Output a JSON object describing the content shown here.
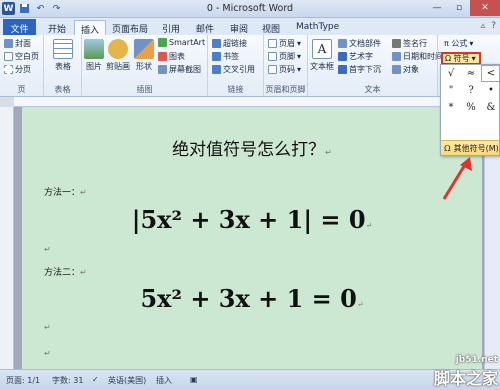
{
  "window": {
    "title": "0 - Microsoft Word",
    "word_icon": "W",
    "undo_icon": "undo-icon",
    "redo_icon": "redo-icon",
    "save_icon": "save-icon"
  },
  "tabs": [
    "文件",
    "开始",
    "插入",
    "页面布局",
    "引用",
    "邮件",
    "审阅",
    "视图",
    "MathType"
  ],
  "ribbon": {
    "pages_group": {
      "items": [
        "封面",
        "空白页",
        "分页"
      ],
      "label": "页"
    },
    "table_group": {
      "button": "表格",
      "label": "表格"
    },
    "illustrations_group": {
      "buttons": [
        "图片",
        "剪贴画",
        "形状"
      ],
      "items": [
        "SmartArt",
        "图表",
        "屏幕截图"
      ],
      "label": "插图"
    },
    "links_group": {
      "items": [
        "超链接",
        "书签",
        "交叉引用"
      ],
      "label": "链接"
    },
    "header_footer_group": {
      "items": [
        "页眉",
        "页脚",
        "页码"
      ],
      "label": "页眉和页脚"
    },
    "text_group": {
      "button": "文本框",
      "items": [
        "文档部件",
        "艺术字",
        "首字下沉"
      ],
      "items2": [
        "签名行",
        "日期和时间",
        "对象"
      ],
      "label": "文本"
    },
    "symbols_group": {
      "equation": "π 公式",
      "symbol_button": "Ω 符号"
    }
  },
  "symbol_panel": {
    "symbols": [
      "√",
      "≈",
      "<",
      "\"",
      "?",
      "•",
      "*",
      "%",
      "&"
    ],
    "other_symbols": "其他符号(M)..."
  },
  "document": {
    "title": "绝对值符号怎么打？",
    "method1": "方法一：",
    "method2": "方法二：",
    "formula1": "|5x² + 3x + 1| = 0",
    "formula2": "5x² + 3x + 1 = 0",
    "para_mark": "↵"
  },
  "status": {
    "page": "页面: 1/1",
    "words": "字数: 31",
    "language": "英语(美国)",
    "mode": "插入",
    "zoom": "100%"
  },
  "watermark": {
    "site": "jb51.net",
    "brand": "脚本之家"
  },
  "colors": {
    "file_tab": "#2b65c0",
    "page_bg": "#cde8d2",
    "highlight": "#e0322d"
  }
}
